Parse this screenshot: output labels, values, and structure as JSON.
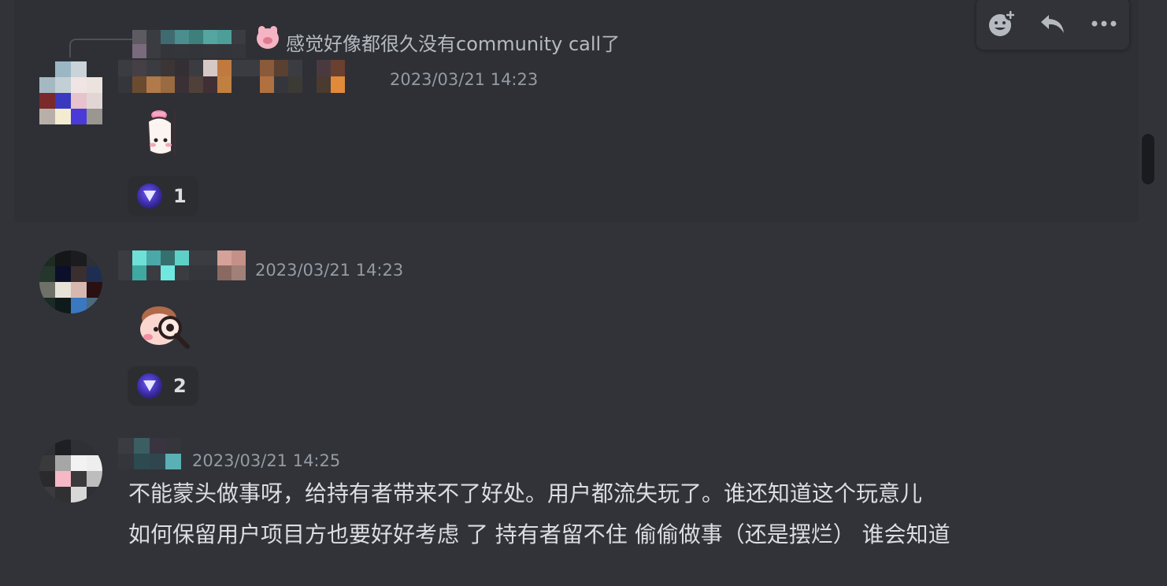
{
  "messages": [
    {
      "reply_preview": {
        "emoji": "pig-emoji",
        "text": "感觉好像都很久没有community call了"
      },
      "timestamp": "2023/03/21 14:23",
      "sticker": "girl-hat-sticker",
      "reaction": {
        "icon": "diamond-emoji",
        "count": "1"
      }
    },
    {
      "timestamp": "2023/03/21 14:23",
      "sticker": "magnifier-face-sticker",
      "reaction": {
        "icon": "diamond-emoji",
        "count": "2"
      }
    },
    {
      "timestamp": "2023/03/21 14:25",
      "text_line_1": "不能蒙头做事呀，给持有者带来不了好处。用户都流失玩了。谁还知道这个玩意儿",
      "text_line_2": "如何保留用户项目方也要好好考虑 了 持有者留不住 偷偷做事（还是摆烂） 谁会知道"
    }
  ],
  "toolbar": {
    "items": [
      "add-reaction-icon",
      "reply-icon",
      "more-icon"
    ]
  },
  "colors": {
    "background": "#313338",
    "hover_background": "#2e3035",
    "text": "#dbdee1",
    "muted": "#949ba4",
    "reaction_bg": "#2b2d31"
  }
}
